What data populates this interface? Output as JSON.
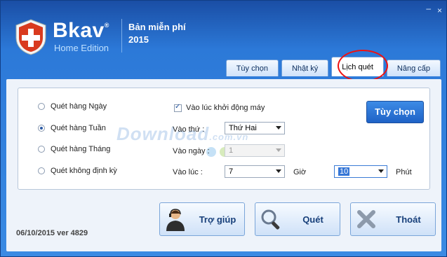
{
  "header": {
    "brand": "Bkav",
    "brand_mark": "®",
    "edition": "Home Edition",
    "free_label": "Bản miễn phí",
    "year": "2015"
  },
  "window_controls": {
    "minimize": "–",
    "close": "×"
  },
  "tabs": [
    {
      "label": "Tùy chọn"
    },
    {
      "label": "Nhật ký"
    },
    {
      "label": "Lịch quét",
      "active": true
    },
    {
      "label": "Nâng cấp"
    }
  ],
  "schedule": {
    "options": [
      {
        "label": "Quét hàng Ngày",
        "selected": false
      },
      {
        "label": "Quét hàng Tuần",
        "selected": true
      },
      {
        "label": "Quét hàng Tháng",
        "selected": false
      },
      {
        "label": "Quét không định kỳ",
        "selected": false
      }
    ],
    "startup_check": {
      "label": "Vào lúc khởi động máy",
      "checked": true
    },
    "weekday_label": "Vào thứ :",
    "weekday_value": "Thứ Hai",
    "day_label": "Vào ngày :",
    "day_value": "1",
    "time_label": "Vào lúc :",
    "hour_value": "7",
    "hour_unit": "Giờ",
    "minute_value": "10",
    "minute_unit": "Phút",
    "options_button": "Tùy chọn"
  },
  "watermark": {
    "main": "Download",
    "suffix": ".com.vn"
  },
  "actions": {
    "help": "Trợ giúp",
    "scan": "Quét",
    "exit": "Thoát"
  },
  "version": "06/10/2015 ver 4829",
  "colors": {
    "accent": "#1e62c6",
    "highlight_circle": "#e11111"
  }
}
